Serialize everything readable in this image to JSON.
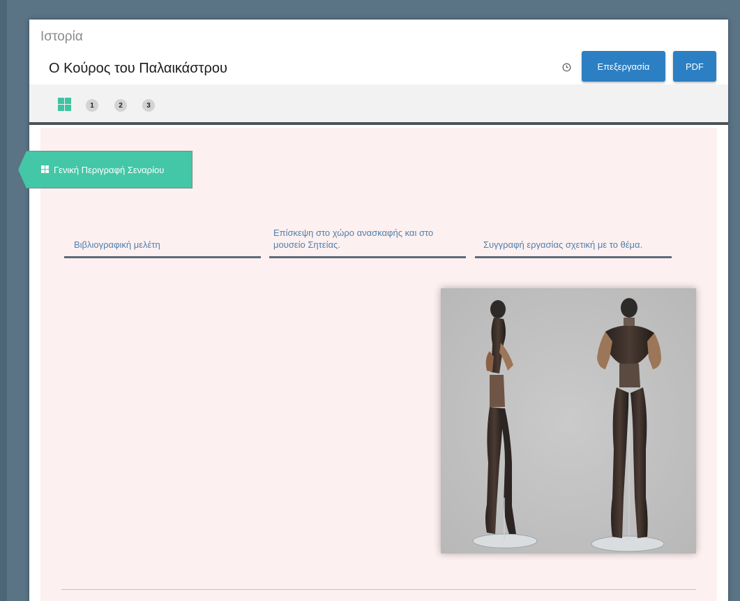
{
  "header": {
    "category": "Ιστορία",
    "title": "Ο Κούρος του Παλαικάστρου",
    "edit_label": "Επεξεργασία",
    "pdf_label": "PDF",
    "clock_icon": "clock-icon"
  },
  "tabs": {
    "overview_icon": "grid-icon",
    "numbers": [
      "1",
      "2",
      "3"
    ]
  },
  "ribbon": {
    "icon": "grid-icon",
    "label": "Γενική Περιγραφή Σεναρίου"
  },
  "steps": [
    "Βιβλιογραφική μελέτη",
    "Επίσκεψη στο χώρο ανασκαφής και στο μουσείο Σητείας.",
    "Συγγραφή εργασίας σχετική με το θέμα."
  ],
  "colors": {
    "primary_button": "#2c7fc3",
    "accent_green": "#3fc4a2",
    "content_background": "#fdf0f0",
    "link_text": "#4e7fad"
  }
}
